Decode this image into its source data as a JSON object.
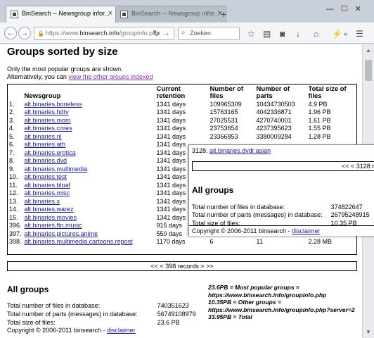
{
  "browser": {
    "tabs": [
      {
        "label": "BinSearch -- Newsgroup infor..."
      },
      {
        "label": "BinSearch -- Newsgroup infor..."
      }
    ],
    "url_prefix": "https://www.",
    "url_domain": "binsearch.info",
    "url_path": "/groupinfo.php",
    "search_placeholder": "Zoeken"
  },
  "page": {
    "title": "Groups sorted by size",
    "intro_line1": "Only the most popular groups are shown.",
    "intro_line2_prefix": "Alternatively, you can ",
    "intro_link": "view the other groups indexed",
    "columns": {
      "newsgroup": "Newsgroup",
      "retention": "Current retention",
      "files": "Number of files",
      "parts": "Number of parts",
      "size": "Total size of files"
    },
    "rows": [
      {
        "num": "1.",
        "group": "alt.binaries.boneless",
        "retention": "1341 days",
        "files": "109965309",
        "parts": "10434730503",
        "size": "4.9 PB"
      },
      {
        "num": "2.",
        "group": "alt.binaries.hdtv",
        "retention": "1341 days",
        "files": "15763165",
        "parts": "4042336871",
        "size": "1.96 PB"
      },
      {
        "num": "3.",
        "group": "alt.binaries.mom",
        "retention": "1341 days",
        "files": "27025531",
        "parts": "4270740001",
        "size": "1.61 PB"
      },
      {
        "num": "4.",
        "group": "alt.binaries.cores",
        "retention": "1341 days",
        "files": "23753654",
        "parts": "4237395623",
        "size": "1.55 PB"
      },
      {
        "num": "5.",
        "group": "alt.binaries.nl",
        "retention": "1341 days",
        "files": "23366853",
        "parts": "3380009284",
        "size": "1.28 PB"
      },
      {
        "num": "6.",
        "group": "alt.binaries.ath",
        "retention": "1341 days",
        "files": "",
        "parts": "",
        "size": ""
      },
      {
        "num": "7.",
        "group": "alt.binaries.erotica",
        "retention": "1341 days",
        "files": "",
        "parts": "",
        "size": ""
      },
      {
        "num": "8.",
        "group": "alt.binaries.dvd",
        "retention": "1341 days",
        "files": "",
        "parts": "",
        "size": ""
      },
      {
        "num": "9.",
        "group": "alt.binaries.multimedia",
        "retention": "1341 days",
        "files": "",
        "parts": "",
        "size": ""
      },
      {
        "num": "10.",
        "group": "alt.binaries.test",
        "retention": "1341 days",
        "files": "",
        "parts": "",
        "size": ""
      },
      {
        "num": "11.",
        "group": "alt.binaries.bloaf",
        "retention": "1341 days",
        "files": "",
        "parts": "",
        "size": ""
      },
      {
        "num": "12.",
        "group": "alt.binaries.misc",
        "retention": "1341 days",
        "files": "",
        "parts": "",
        "size": ""
      },
      {
        "num": "13.",
        "group": "alt.binaries.x",
        "retention": "1341 days",
        "files": "",
        "parts": "",
        "size": ""
      },
      {
        "num": "14.",
        "group": "alt.binaries.warez",
        "retention": "1341 days",
        "files": "",
        "parts": "",
        "size": ""
      },
      {
        "num": "15.",
        "group": "alt.binaries.movies",
        "retention": "1341 days",
        "files": "",
        "parts": "",
        "size": ""
      },
      {
        "num": "396.",
        "group": "alt.binaries.ftn.music",
        "retention": "915 days",
        "files": "",
        "parts": "",
        "size": ""
      },
      {
        "num": "397.",
        "group": "alt.binaries.pictures.anime",
        "retention": "550 days",
        "files": "106",
        "parts": "114",
        "size": "15.59 MB"
      },
      {
        "num": "398.",
        "group": "alt.binaries.multimedia.cartoons.repost",
        "retention": "1170 days",
        "files": "6",
        "parts": "11",
        "size": "2.28 MB"
      }
    ],
    "pager": "<< < 398 records > >>",
    "all_groups_heading": "All groups",
    "stats": [
      {
        "label": "Total number of files in database:",
        "value": "740351623"
      },
      {
        "label": "Total number of parts (messages) in database:",
        "value": "56749108979"
      },
      {
        "label": "Total size of files:",
        "value": "23.6 PB"
      }
    ],
    "formula": [
      "23.6PB = Most popular groups =",
      "https://www.binsearch.info/groupinfo.php",
      "10.35PB = Other groups =",
      "https://www.binsearch.info/groupinfo.php?server=2",
      "33.95PB = Total"
    ],
    "copyright_prefix": "Copyright © 2006-2011 binsearch - ",
    "copyright_link": "disclaimer"
  },
  "overlay": {
    "row_num": "3128.",
    "row_group": "alt.binaries.dvdr.asian",
    "pager": "<< < 3128 rec",
    "heading": "All groups",
    "stats": [
      {
        "label": "Total number of files in database:",
        "value": "374822647"
      },
      {
        "label": "Total number of parts (messages) in database:",
        "value": "26795248915"
      },
      {
        "label": "Total size of files:",
        "value": "10.35 PB"
      }
    ],
    "copyright_prefix": "Copyright © 2006-2011 binsearch - ",
    "copyright_link": "disclaimer"
  }
}
